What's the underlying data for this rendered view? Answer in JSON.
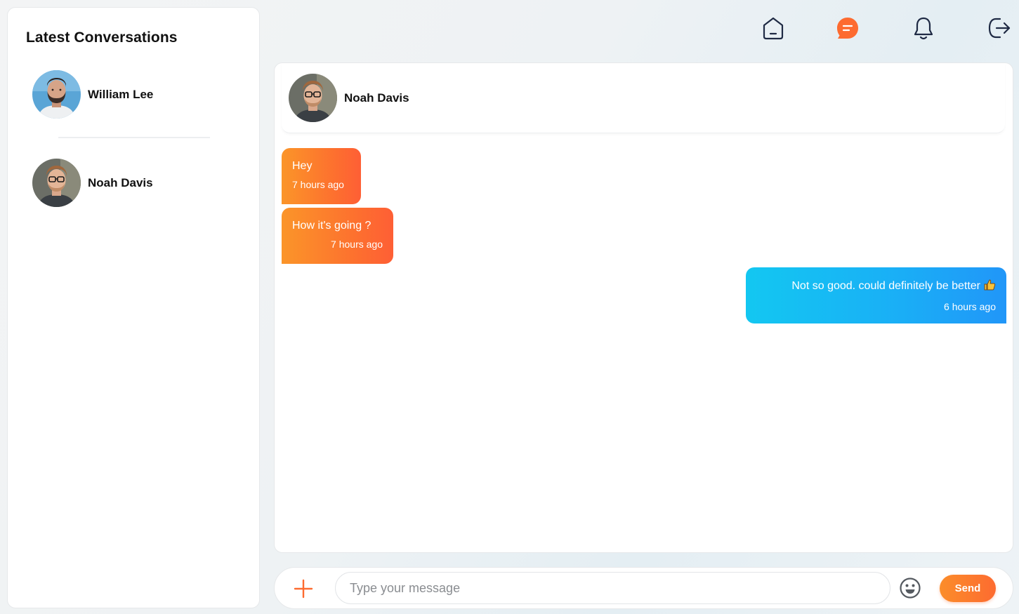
{
  "sidebar": {
    "title": "Latest Conversations",
    "conversations": [
      {
        "name": "William Lee",
        "avatar": "man-with-beard-avatar"
      },
      {
        "name": "Noah Davis",
        "avatar": "man-with-glasses-avatar"
      }
    ]
  },
  "nav": {
    "icons": [
      "home-icon",
      "chat-icon",
      "bell-icon",
      "logout-icon"
    ],
    "active": "chat-icon"
  },
  "chat": {
    "contact_name": "Noah Davis",
    "messages": [
      {
        "direction": "incoming",
        "text": "Hey",
        "time": "7 hours ago"
      },
      {
        "direction": "incoming",
        "text": "How it's going ?",
        "time": "7 hours ago"
      },
      {
        "direction": "outgoing",
        "text": "Not so good. could definitely be better",
        "emoji": "thumbs-up",
        "time": "6 hours ago"
      }
    ]
  },
  "composer": {
    "placeholder": "Type your message",
    "send_label": "Send"
  },
  "colors": {
    "accent": "#fd6b30",
    "incoming_start": "#fb9529",
    "incoming_end": "#fe5f35",
    "outgoing_start": "#13c7f1",
    "outgoing_end": "#2196f8",
    "icon_stroke": "#1f2a44"
  }
}
